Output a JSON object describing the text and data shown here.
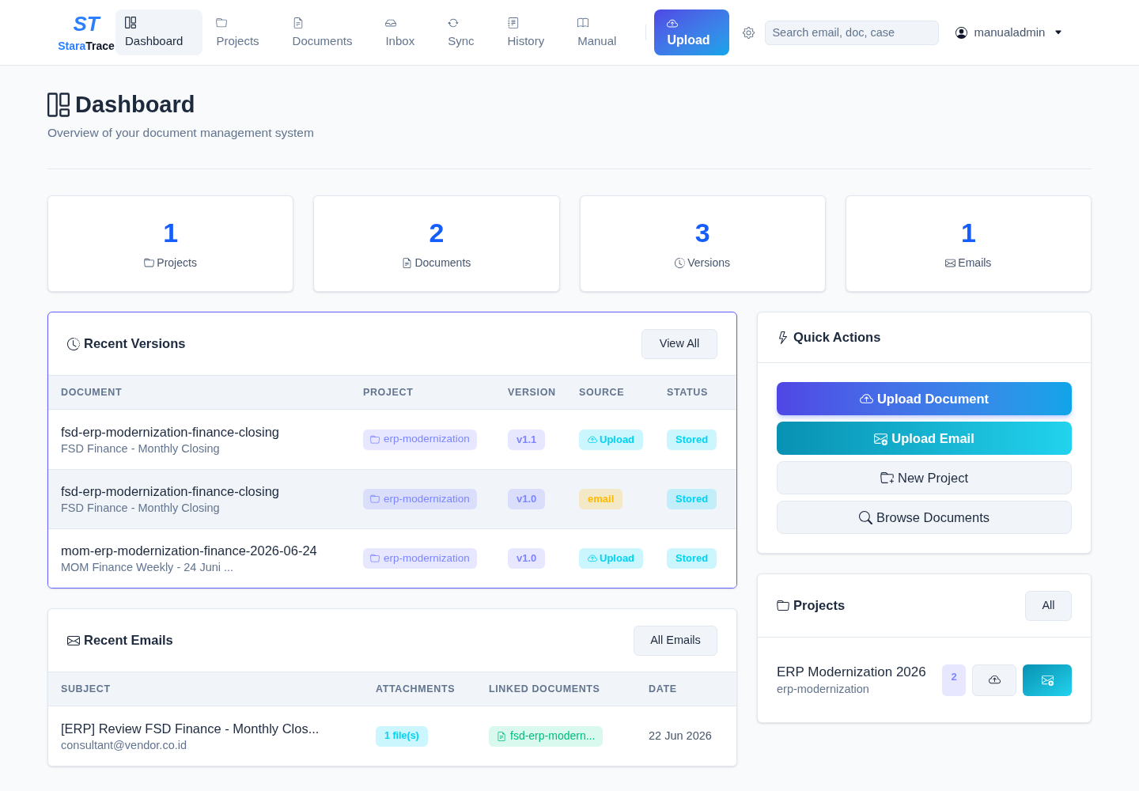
{
  "nav": {
    "logo": {
      "mark": "ST",
      "name_part_1": "Stara",
      "name_part_2": "Trace"
    },
    "items": [
      {
        "label": "Dashboard",
        "selected": true
      },
      {
        "label": "Projects",
        "selected": false
      },
      {
        "label": "Documents",
        "selected": false
      },
      {
        "label": "Inbox",
        "selected": false
      },
      {
        "label": "Sync",
        "selected": false
      },
      {
        "label": "History",
        "selected": false
      },
      {
        "label": "Manual",
        "selected": false
      }
    ],
    "upload_button": "Upload",
    "search": {
      "placeholder": "Search email, doc, case"
    },
    "user": {
      "name": "manualadmin"
    }
  },
  "page_header": {
    "title": "Dashboard",
    "subtitle": "Overview of your document management system"
  },
  "stats": [
    {
      "value": "1",
      "label": "Projects"
    },
    {
      "value": "2",
      "label": "Documents"
    },
    {
      "value": "3",
      "label": "Versions"
    },
    {
      "value": "1",
      "label": "Emails"
    }
  ],
  "recent_versions": {
    "title": "Recent Versions",
    "highlighted": true,
    "button": "View All",
    "columns": [
      "DOCUMENT",
      "PROJECT",
      "VERSION",
      "SOURCE",
      "STATUS"
    ],
    "rows": [
      {
        "document": "fsd-erp-modernization-finance-closing",
        "description": "FSD Finance - Monthly Closing",
        "project": "erp-modernization",
        "version": "v1.1",
        "source": {
          "label": "Upload",
          "kind": "upload"
        },
        "status": "Stored",
        "highlighted": false
      },
      {
        "document": "fsd-erp-modernization-finance-closing",
        "description": "FSD Finance - Monthly Closing",
        "project": "erp-modernization",
        "version": "v1.0",
        "source": {
          "label": "email",
          "kind": "email"
        },
        "status": "Stored",
        "highlighted": true
      },
      {
        "document": "mom-erp-modernization-finance-2026-06-24",
        "description": "MOM Finance Weekly - 24 Juni ...",
        "project": "erp-modernization",
        "version": "v1.0",
        "source": {
          "label": "Upload",
          "kind": "upload"
        },
        "status": "Stored",
        "highlighted": false
      }
    ]
  },
  "recent_emails": {
    "title": "Recent Emails",
    "highlighted": false,
    "button": "All Emails",
    "columns": [
      "SUBJECT",
      "ATTACHMENTS",
      "LINKED DOCUMENTS",
      "DATE"
    ],
    "rows": [
      {
        "subject": "[ERP] Review FSD Finance - Monthly Clos...",
        "sender": "consultant@vendor.co.id",
        "attachments": "1 file(s)",
        "linked_document": "fsd-erp-modern...",
        "date": "22 Jun 2026",
        "highlighted": false
      }
    ]
  },
  "quick_actions": {
    "title": "Quick Actions",
    "buttons": [
      {
        "label": "Upload Document",
        "kind": "primary"
      },
      {
        "label": "Upload Email",
        "kind": "accent"
      },
      {
        "label": "New Project",
        "kind": "secondary"
      },
      {
        "label": "Browse Documents",
        "kind": "secondary"
      }
    ]
  },
  "projects": {
    "title": "Projects",
    "button": "All",
    "items": [
      {
        "name": "ERP Modernization 2026",
        "slug": "erp-modernization",
        "document_count": "2"
      }
    ]
  }
}
